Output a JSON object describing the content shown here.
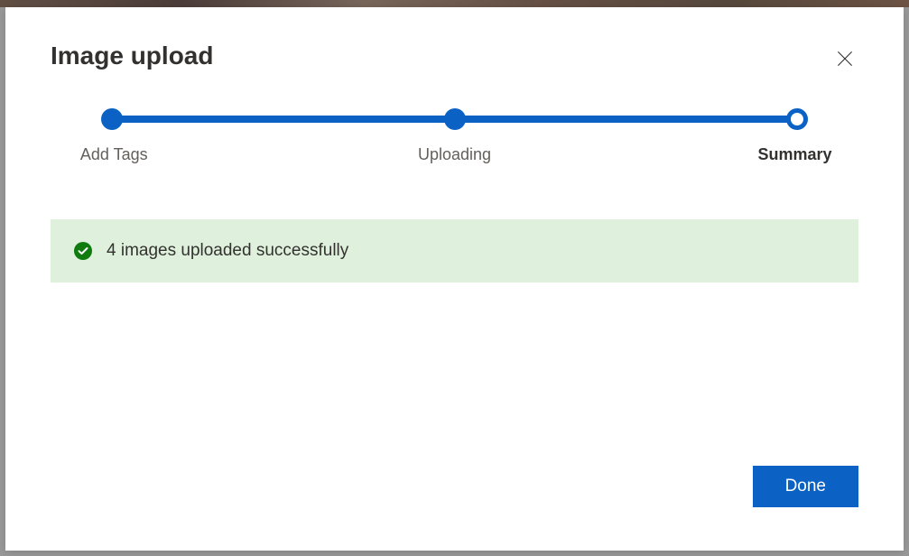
{
  "dialog": {
    "title": "Image upload",
    "steps": {
      "step1_label": "Add Tags",
      "step2_label": "Uploading",
      "step3_label": "Summary"
    },
    "status_message": "4 images uploaded successfully",
    "done_button_label": "Done"
  }
}
